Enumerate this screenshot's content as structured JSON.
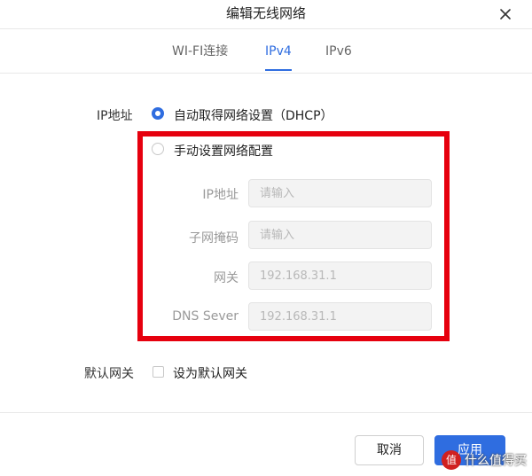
{
  "dialog": {
    "title": "编辑无线网络",
    "close_icon": "close-icon"
  },
  "tabs": [
    {
      "label": "WI-FI连接",
      "active": false
    },
    {
      "label": "IPv4",
      "active": true
    },
    {
      "label": "IPv6",
      "active": false
    }
  ],
  "ip_address": {
    "label": "IP地址",
    "options": [
      {
        "label": "自动取得网络设置（DHCP）",
        "selected": true
      },
      {
        "label": "手动设置网络配置",
        "selected": false
      }
    ]
  },
  "manual": {
    "fields": [
      {
        "label": "IP地址",
        "value": "",
        "placeholder": "请输入"
      },
      {
        "label": "子网掩码",
        "value": "",
        "placeholder": "请输入"
      },
      {
        "label": "网关",
        "value": "",
        "placeholder": "192.168.31.1"
      },
      {
        "label": "DNS Sever",
        "value": "",
        "placeholder": "192.168.31.1"
      }
    ]
  },
  "default_gateway": {
    "label": "默认网关",
    "checkbox_label": "设为默认网关",
    "checked": false
  },
  "buttons": {
    "cancel": "取消",
    "apply": "应用"
  },
  "watermark": {
    "logo_text": "值",
    "text": "什么值得买"
  },
  "colors": {
    "accent": "#2f6de0",
    "highlight_box": "#e6000e"
  }
}
